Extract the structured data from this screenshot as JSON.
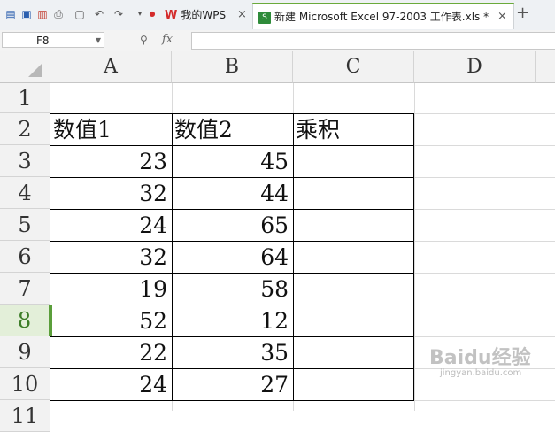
{
  "toolbar": {
    "icons": [
      "logo-icon",
      "save-icon",
      "export-pdf-icon",
      "print-icon",
      "print-preview-icon",
      "undo-icon",
      "redo-icon",
      "more-icon"
    ]
  },
  "tabs": [
    {
      "label": "我的WPS",
      "close": "×"
    },
    {
      "label": "新建 Microsoft Excel 97-2003 工作表.xls *",
      "close": "×"
    }
  ],
  "new_tab": "+",
  "formula_bar": {
    "cell_ref": "F8",
    "fx": "fx",
    "formula": ""
  },
  "columns": [
    "A",
    "B",
    "C",
    "D"
  ],
  "rows": [
    "1",
    "2",
    "3",
    "4",
    "5",
    "6",
    "7",
    "8",
    "9",
    "10",
    "11"
  ],
  "active_row": "8",
  "table": {
    "headers": [
      "数值1",
      "数值2",
      "乘积"
    ],
    "values1": [
      "23",
      "32",
      "24",
      "32",
      "19",
      "52",
      "22",
      "24"
    ],
    "values2": [
      "45",
      "44",
      "65",
      "64",
      "58",
      "12",
      "35",
      "27"
    ],
    "product": [
      "",
      "",
      "",
      "",
      "",
      "",
      "",
      ""
    ]
  },
  "watermark": {
    "text": "Baidu经验",
    "sub": "jingyan.baidu.com"
  },
  "colors": {
    "active_tab_accent": "#6aaa3a",
    "active_row_header": "#3d7d28",
    "wps_red": "#d42c2c"
  }
}
